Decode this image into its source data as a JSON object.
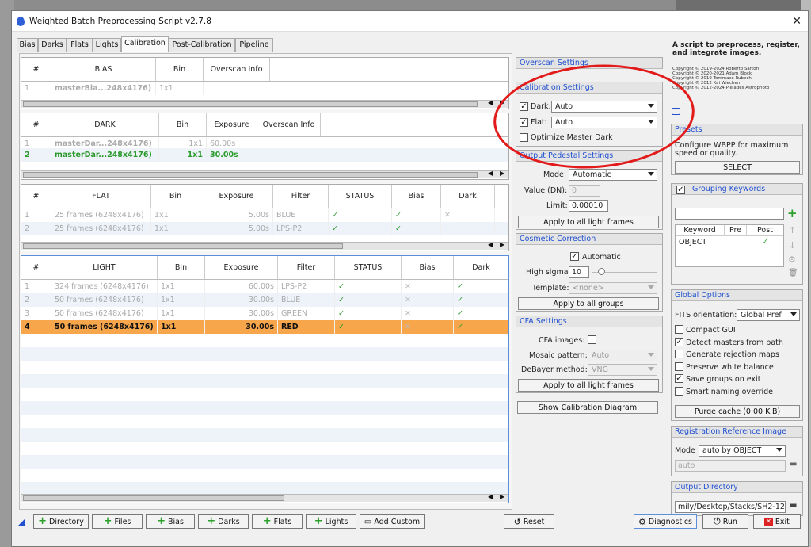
{
  "window": {
    "title": "Weighted Batch Preprocessing Script v2.7.8",
    "close": "✕"
  },
  "tabs": [
    "Bias",
    "Darks",
    "Flats",
    "Lights",
    "Calibration",
    "Post-Calibration",
    "Pipeline"
  ],
  "bias_grid": {
    "headers": [
      "#",
      "BIAS",
      "Bin",
      "Overscan Info"
    ],
    "rows": [
      [
        "1",
        "masterBia...248x4176)",
        "1x1"
      ]
    ]
  },
  "dark_grid": {
    "headers": [
      "#",
      "DARK",
      "Bin",
      "Exposure",
      "Overscan Info"
    ],
    "rows": [
      [
        "1",
        "masterDar...248x4176)",
        "1x1",
        "60.00s"
      ],
      [
        "2",
        "masterDar...248x4176)",
        "1x1",
        "30.00s"
      ]
    ]
  },
  "flat_grid": {
    "headers": [
      "#",
      "FLAT",
      "Bin",
      "Exposure",
      "Filter",
      "STATUS",
      "Bias",
      "Dark"
    ],
    "rows": [
      [
        "1",
        "25 frames (6248x4176)",
        "1x1",
        "5.00s",
        "BLUE"
      ],
      [
        "2",
        "25 frames (6248x4176)",
        "1x1",
        "5.00s",
        "LPS-P2"
      ]
    ]
  },
  "light_grid": {
    "headers": [
      "#",
      "LIGHT",
      "Bin",
      "Exposure",
      "Filter",
      "STATUS",
      "Bias",
      "Dark"
    ],
    "rows": [
      [
        "1",
        "324 frames (6248x4176)",
        "1x1",
        "60.00s",
        "LPS-P2"
      ],
      [
        "2",
        "50 frames (6248x4176)",
        "1x1",
        "30.00s",
        "BLUE"
      ],
      [
        "3",
        "50 frames (6248x4176)",
        "1x1",
        "30.00s",
        "GREEN"
      ],
      [
        "4",
        "50 frames (6248x4176)",
        "1x1",
        "30.00s",
        "RED"
      ]
    ]
  },
  "overscan": {
    "title": "Overscan Settings"
  },
  "calibration": {
    "title": "Calibration Settings",
    "dark_label": "Dark:",
    "dark_value": "Auto",
    "flat_label": "Flat:",
    "flat_value": "Auto",
    "optimize_label": "Optimize Master Dark"
  },
  "pedestal": {
    "title": "Output Pedestal Settings",
    "mode_label": "Mode:",
    "mode_value": "Automatic",
    "value_label": "Value (DN):",
    "value_value": "0",
    "limit_label": "Limit:",
    "limit_value": "0.00010",
    "apply": "Apply to all light frames"
  },
  "cosmetic": {
    "title": "Cosmetic Correction",
    "auto_label": "Automatic",
    "sigma_label": "High sigma:",
    "sigma_value": "10",
    "template_label": "Template:",
    "template_value": "<none>",
    "apply": "Apply to all groups"
  },
  "cfa": {
    "title": "CFA Settings",
    "cfa_label": "CFA images:",
    "mosaic_label": "Mosaic pattern:",
    "mosaic_value": "Auto",
    "debayer_label": "DeBayer method:",
    "debayer_value": "VNG",
    "apply": "Apply to all light frames"
  },
  "show_diagram": "Show Calibration Diagram",
  "info": {
    "desc": "A script to preprocess, register, and integrate images.",
    "copyright": [
      "Copyright © 2019-2024 Roberto Sartori",
      "Copyright © 2020-2021 Adam Block",
      "Copyright © 2019 Tommaso Rubechi",
      "Copyright © 2012 Kai Wiechen",
      "Copyright © 2012-2024 Pleiades Astrophoto"
    ]
  },
  "presets": {
    "title": "Presets",
    "text": "Configure WBPP for maximum speed or quality.",
    "select": "SELECT"
  },
  "grouping": {
    "title": "Grouping Keywords",
    "headers": [
      "Keyword",
      "Pre",
      "Post"
    ],
    "rows": [
      [
        "OBJECT",
        "",
        "✓"
      ]
    ]
  },
  "global": {
    "title": "Global Options",
    "fits_label": "FITS orientation:",
    "fits_value": "Global Pref",
    "options": [
      "Compact GUI",
      "Detect masters from path",
      "Generate rejection maps",
      "Preserve white balance",
      "Save groups on exit",
      "Smart naming override"
    ],
    "checked": [
      false,
      true,
      false,
      false,
      true,
      false
    ],
    "purge": "Purge cache (0.00 KiB)"
  },
  "registration": {
    "title": "Registration Reference Image",
    "mode_label": "Mode",
    "mode_value": "auto by OBJECT",
    "field_value": "auto"
  },
  "output": {
    "title": "Output Directory",
    "path": "mily/Desktop/Stacks/SH2-126"
  },
  "bottom": {
    "directory": "Directory",
    "files": "Files",
    "bias": "Bias",
    "darks": "Darks",
    "flats": "Flats",
    "lights": "Lights",
    "add_custom": "Add Custom",
    "reset": "Reset",
    "diagnostics": "Diagnostics",
    "run": "Run",
    "exit": "Exit"
  },
  "colors": {
    "accent": "#2050d0",
    "highlight_row": "#f7a64c",
    "check": "#2a9a2a",
    "annotation": "#e21a1a"
  }
}
